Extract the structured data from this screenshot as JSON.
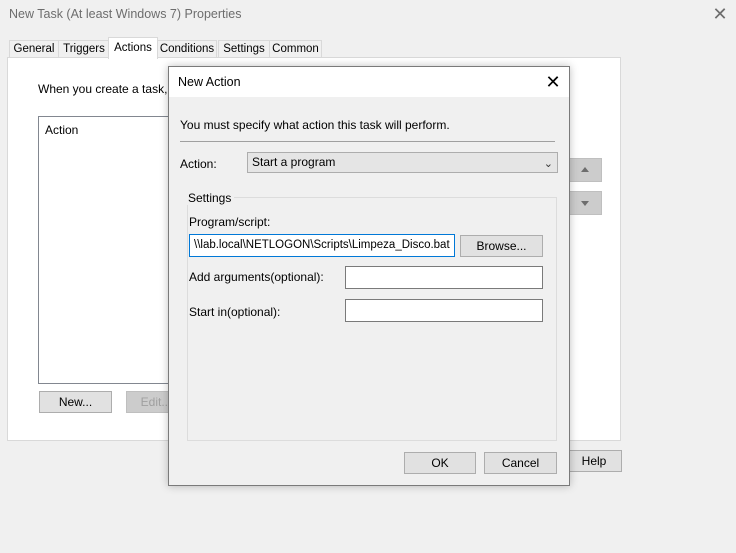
{
  "window": {
    "title": "New Task (At least Windows 7) Properties",
    "close_glyph": "✕"
  },
  "tabs": [
    {
      "label": "General"
    },
    {
      "label": "Triggers"
    },
    {
      "label": "Actions",
      "active": true
    },
    {
      "label": "Conditions"
    },
    {
      "label": "Settings"
    },
    {
      "label": "Common"
    }
  ],
  "actions_tab": {
    "intro": "When you create a task, yo",
    "list_header": "Action",
    "new_label": "New...",
    "edit_label": "Edit...",
    "help_label": "Help"
  },
  "dialog": {
    "title": "New Action",
    "close_glyph": "✕",
    "instruction": "You must specify what action this task will perform.",
    "action_label": "Action:",
    "action_value": "Start a program",
    "settings_legend": "Settings",
    "program_label": "Program/script:",
    "program_value": "\\\\lab.local\\NETLOGON\\Scripts\\Limpeza_Disco.bat",
    "browse_label": "Browse...",
    "args_label": "Add arguments(optional):",
    "args_value": "",
    "startin_label": "Start in(optional):",
    "startin_value": "",
    "ok_label": "OK",
    "cancel_label": "Cancel"
  },
  "icons": {
    "chevron": "chevron-down-icon",
    "up": "arrow-up-icon",
    "down": "arrow-down-icon"
  }
}
